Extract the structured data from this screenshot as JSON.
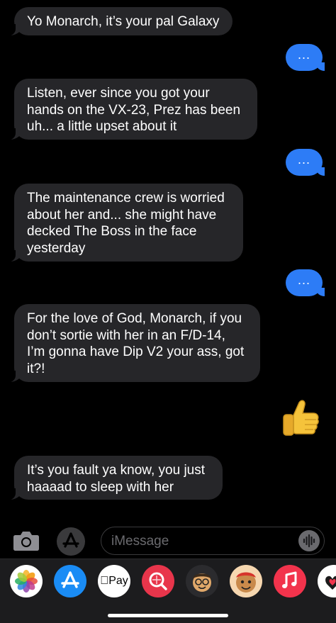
{
  "messages": [
    {
      "from": "them",
      "text": "Yo Monarch, it’s your pal Galaxy"
    },
    {
      "from": "me",
      "text": "..."
    },
    {
      "from": "them",
      "lines": [
        "Listen, ever since you got your",
        "hands on the VX-23, Prez has been",
        "uh... a little upset about it"
      ]
    },
    {
      "from": "me",
      "text": "..."
    },
    {
      "from": "them",
      "lines": [
        "The maintenance crew is worried",
        "about her and... she might have",
        "decked The Boss in the face",
        "yesterday"
      ]
    },
    {
      "from": "me",
      "text": "..."
    },
    {
      "from": "them",
      "lines": [
        "For the love of God, Monarch, if you",
        "don’t sortie with her in an F/D-14,",
        "I’m gonna have Dip V2 your ass, got",
        "it?!"
      ]
    },
    {
      "from": "me",
      "emoji": "thumbs-up"
    },
    {
      "from": "them",
      "lines": [
        "It’s you fault ya know, you just",
        "haaaad to sleep with her"
      ]
    }
  ],
  "input": {
    "placeholder": "iMessage"
  },
  "apps": [
    {
      "icon": "photos-icon"
    },
    {
      "icon": "app-store-icon"
    },
    {
      "icon": "apple-pay-icon",
      "label": "Pay"
    },
    {
      "icon": "image-search-icon"
    },
    {
      "icon": "memoji-icon"
    },
    {
      "icon": "animoji-icon"
    },
    {
      "icon": "music-icon"
    },
    {
      "icon": "digital-touch-icon"
    }
  ],
  "colors": {
    "incoming_bubble": "#262629",
    "outgoing_bubble": "#2d7cf6",
    "background": "#000000",
    "drawer": "#1c1c1e"
  }
}
